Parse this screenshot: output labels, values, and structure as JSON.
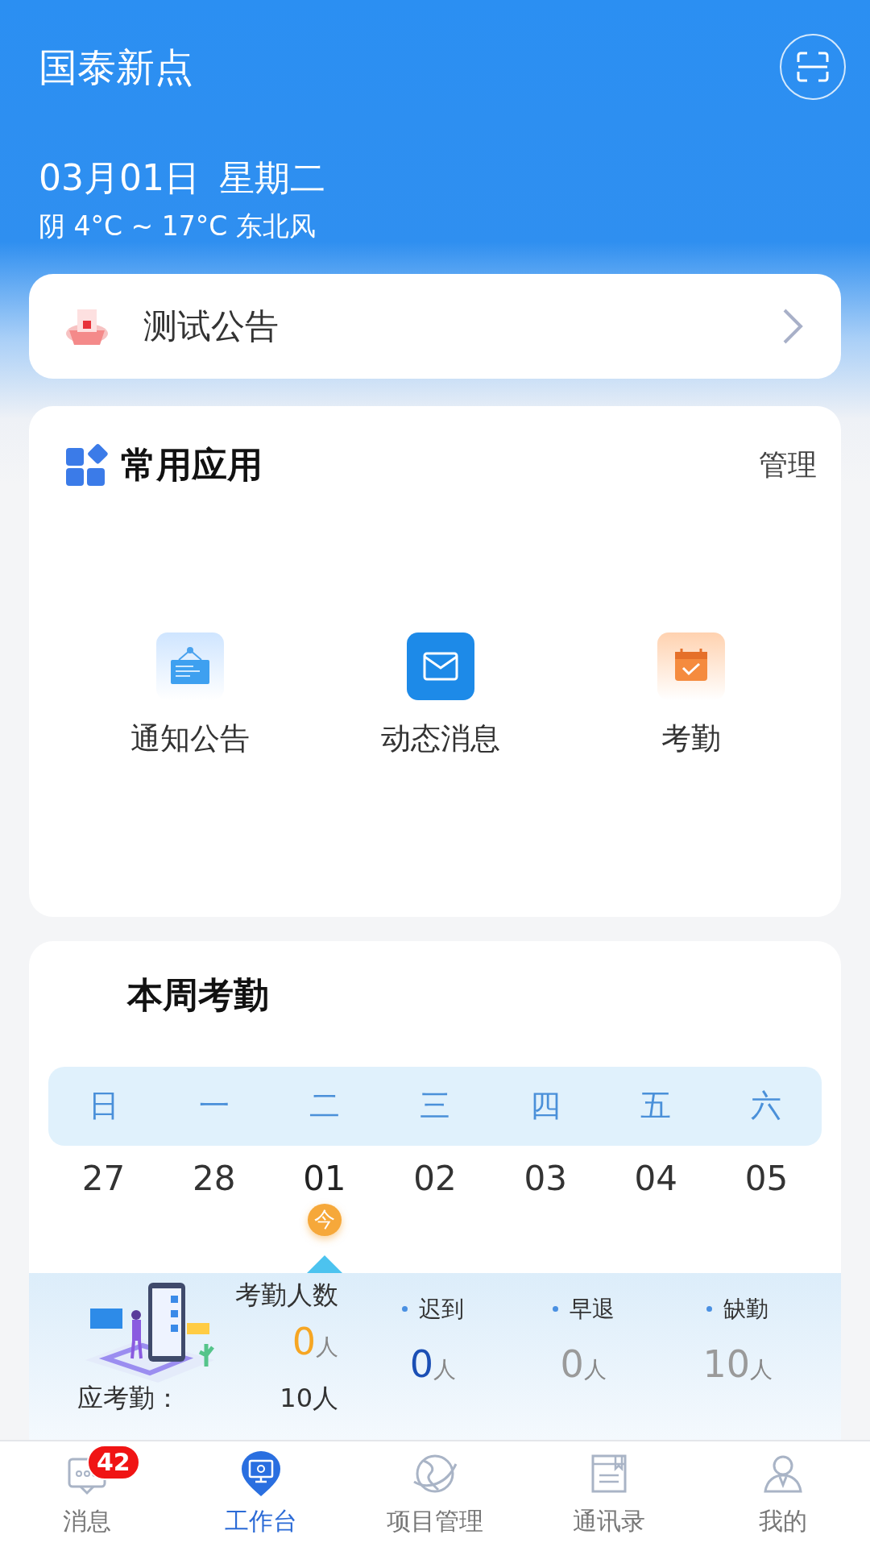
{
  "header": {
    "title": "国泰新点",
    "date": "03月01日",
    "weekday": "星期二",
    "weather": "阴 4°C ~ 17°C 东北风"
  },
  "notice": {
    "text": "测试公告"
  },
  "apps": {
    "title": "常用应用",
    "manage": "管理",
    "items": [
      {
        "label": "通知公告",
        "kind": "notice"
      },
      {
        "label": "动态消息",
        "kind": "message"
      },
      {
        "label": "考勤",
        "kind": "attendance"
      }
    ]
  },
  "attendance": {
    "title": "本周考勤",
    "weekdays": [
      "日",
      "一",
      "二",
      "三",
      "四",
      "五",
      "六"
    ],
    "dates": [
      {
        "label": "27",
        "selected": false
      },
      {
        "label": "28",
        "selected": false
      },
      {
        "label": "01",
        "selected": true
      },
      {
        "label": "02",
        "selected": false
      },
      {
        "label": "03",
        "selected": false
      },
      {
        "label": "04",
        "selected": false
      },
      {
        "label": "05",
        "selected": false
      }
    ],
    "today_badge": "今",
    "summary": {
      "label": "考勤人数",
      "value": "0",
      "unit": "人"
    },
    "expected": {
      "label": "应考勤：",
      "value": "10",
      "unit": "人"
    },
    "stats": [
      {
        "label": "迟到",
        "value": "0",
        "unit": "人",
        "color": "#1b4fb5"
      },
      {
        "label": "早退",
        "value": "0",
        "unit": "人",
        "color": "#9a9a9a"
      },
      {
        "label": "缺勤",
        "value": "10",
        "unit": "人",
        "color": "#9a9a9a"
      }
    ]
  },
  "nav": [
    {
      "label": "消息",
      "selected": false,
      "badge": "42",
      "kind": "message"
    },
    {
      "label": "工作台",
      "selected": true,
      "kind": "desk"
    },
    {
      "label": "项目管理",
      "selected": false,
      "kind": "globe"
    },
    {
      "label": "通讯录",
      "selected": false,
      "kind": "book"
    },
    {
      "label": "我的",
      "selected": false,
      "kind": "person"
    }
  ]
}
